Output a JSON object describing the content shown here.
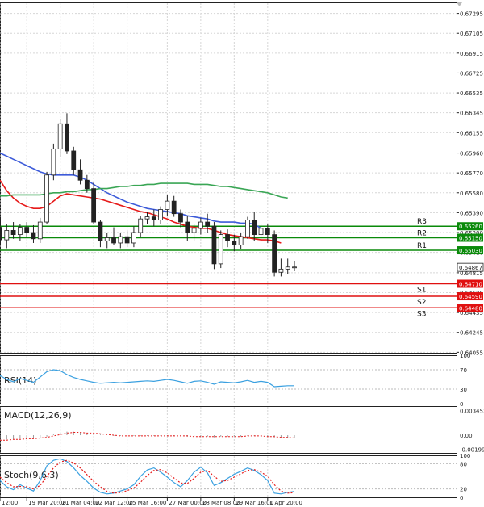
{
  "chart_data": [
    {
      "panel": "price",
      "type": "candlestick",
      "ylim": [
        0.6405,
        0.674
      ],
      "y_ticks": [
        "0.67295",
        "0.67105",
        "0.66915",
        "0.66725",
        "0.66535",
        "0.66345",
        "0.66155",
        "0.65960",
        "0.65770",
        "0.65580",
        "0.65390",
        "0.65200",
        "0.65010",
        "0.64815",
        "0.64625",
        "0.64435",
        "0.64245",
        "0.64055"
      ],
      "current_price": {
        "label": "0.64867",
        "value": 0.64867
      },
      "levels": [
        {
          "name": "R3",
          "value": 0.6526,
          "label": "0.65260",
          "kind": "resistance",
          "color": "#0a8a0a"
        },
        {
          "name": "R2",
          "value": 0.6515,
          "label": "0.65150",
          "kind": "resistance",
          "color": "#0a8a0a"
        },
        {
          "name": "R1",
          "value": 0.6503,
          "label": "0.65030",
          "kind": "resistance",
          "color": "#0a8a0a"
        },
        {
          "name": "S1",
          "value": 0.6471,
          "label": "0.64710",
          "kind": "support",
          "color": "#e01010"
        },
        {
          "name": "S2",
          "value": 0.6459,
          "label": "0.64590",
          "kind": "support",
          "color": "#e01010"
        },
        {
          "name": "S3",
          "value": 0.6448,
          "label": "0.64480",
          "kind": "support",
          "color": "#e01010"
        }
      ],
      "candles": [
        [
          0.6525,
          0.6535,
          0.6508,
          0.6513
        ],
        [
          0.6513,
          0.6528,
          0.6505,
          0.6522
        ],
        [
          0.6522,
          0.653,
          0.6514,
          0.6518
        ],
        [
          0.6518,
          0.6528,
          0.6512,
          0.6525
        ],
        [
          0.6525,
          0.653,
          0.6515,
          0.652
        ],
        [
          0.652,
          0.6527,
          0.651,
          0.6514
        ],
        [
          0.6514,
          0.6534,
          0.651,
          0.653
        ],
        [
          0.653,
          0.6578,
          0.6528,
          0.6575
        ],
        [
          0.6575,
          0.6605,
          0.657,
          0.66
        ],
        [
          0.66,
          0.6628,
          0.6592,
          0.6624
        ],
        [
          0.6624,
          0.6634,
          0.6595,
          0.6598
        ],
        [
          0.6598,
          0.6602,
          0.6575,
          0.658
        ],
        [
          0.658,
          0.659,
          0.6566,
          0.657
        ],
        [
          0.657,
          0.6575,
          0.6558,
          0.6562
        ],
        [
          0.6562,
          0.6568,
          0.6528,
          0.653
        ],
        [
          0.653,
          0.6532,
          0.6506,
          0.6512
        ],
        [
          0.6512,
          0.652,
          0.6505,
          0.6515
        ],
        [
          0.6515,
          0.6525,
          0.6508,
          0.651
        ],
        [
          0.651,
          0.652,
          0.6505,
          0.6516
        ],
        [
          0.6516,
          0.6522,
          0.6506,
          0.651
        ],
        [
          0.651,
          0.6526,
          0.6506,
          0.652
        ],
        [
          0.652,
          0.6536,
          0.6516,
          0.6533
        ],
        [
          0.6533,
          0.654,
          0.6528,
          0.6535
        ],
        [
          0.6535,
          0.6542,
          0.6526,
          0.6532
        ],
        [
          0.6532,
          0.6545,
          0.6528,
          0.6542
        ],
        [
          0.6542,
          0.6556,
          0.6536,
          0.655
        ],
        [
          0.655,
          0.6555,
          0.6535,
          0.6538
        ],
        [
          0.6538,
          0.6542,
          0.6525,
          0.653
        ],
        [
          0.653,
          0.6536,
          0.6512,
          0.652
        ],
        [
          0.652,
          0.6528,
          0.6512,
          0.6524
        ],
        [
          0.6524,
          0.6534,
          0.6518,
          0.653
        ],
        [
          0.653,
          0.6538,
          0.652,
          0.6526
        ],
        [
          0.6526,
          0.653,
          0.6485,
          0.649
        ],
        [
          0.649,
          0.6522,
          0.6486,
          0.6518
        ],
        [
          0.6518,
          0.6523,
          0.6506,
          0.6512
        ],
        [
          0.6512,
          0.6518,
          0.6502,
          0.6508
        ],
        [
          0.6508,
          0.652,
          0.6504,
          0.6516
        ],
        [
          0.6516,
          0.6535,
          0.6514,
          0.6532
        ],
        [
          0.6532,
          0.654,
          0.6512,
          0.6518
        ],
        [
          0.6518,
          0.6528,
          0.6512,
          0.6524
        ],
        [
          0.6524,
          0.6528,
          0.651,
          0.6518
        ],
        [
          0.6518,
          0.6522,
          0.6478,
          0.6482
        ],
        [
          0.6482,
          0.6495,
          0.6478,
          0.6485
        ],
        [
          0.6485,
          0.6495,
          0.648,
          0.6487
        ],
        [
          0.6487,
          0.6493,
          0.6483,
          0.6487
        ]
      ],
      "moving_averages": [
        {
          "color": "#3d5bd9",
          "start_index": 0,
          "values": [
            0.6596,
            0.6593,
            0.659,
            0.6587,
            0.6584,
            0.6581,
            0.6578,
            0.6576,
            0.6575,
            0.6575,
            0.6575,
            0.6575,
            0.6573,
            0.657,
            0.6566,
            0.6562,
            0.6558,
            0.6555,
            0.6552,
            0.6549,
            0.6547,
            0.6545,
            0.6543,
            0.6542,
            0.6541,
            0.654,
            0.6539,
            0.6538,
            0.6536,
            0.6535,
            0.6534,
            0.6533,
            0.6531,
            0.653,
            0.653,
            0.653,
            0.6529,
            0.6529,
            0.6528,
            0.6524
          ]
        },
        {
          "color": "#e61a1a",
          "start_index": 0,
          "values": [
            0.657,
            0.656,
            0.6553,
            0.6548,
            0.6545,
            0.6543,
            0.6543,
            0.6545,
            0.655,
            0.6555,
            0.6557,
            0.6556,
            0.6555,
            0.6554,
            0.6553,
            0.6552,
            0.655,
            0.6548,
            0.6546,
            0.6544,
            0.6542,
            0.654,
            0.6539,
            0.6537,
            0.6535,
            0.6533,
            0.653,
            0.6528,
            0.6526,
            0.6525,
            0.6524,
            0.6524,
            0.6522,
            0.652,
            0.6518,
            0.6517,
            0.6516,
            0.6515,
            0.6514,
            0.6513,
            0.6513,
            0.6512,
            0.651
          ]
        },
        {
          "color": "#3aa655",
          "start_index": 0,
          "values": [
            0.6555,
            0.6555,
            0.6556,
            0.6556,
            0.6556,
            0.6556,
            0.6556,
            0.6557,
            0.6558,
            0.6558,
            0.6559,
            0.6559,
            0.656,
            0.6561,
            0.6561,
            0.6562,
            0.6562,
            0.6563,
            0.6564,
            0.6564,
            0.6565,
            0.6565,
            0.6566,
            0.6566,
            0.6567,
            0.6567,
            0.6567,
            0.6567,
            0.6567,
            0.6566,
            0.6566,
            0.6566,
            0.6565,
            0.6564,
            0.6564,
            0.6563,
            0.6562,
            0.6561,
            0.656,
            0.6559,
            0.6558,
            0.6556,
            0.6554,
            0.6553
          ]
        }
      ]
    },
    {
      "panel": "rsi",
      "type": "line",
      "indicator": "RSI(14)",
      "ylim": [
        0,
        100
      ],
      "y_ticks": [
        {
          "label": "100",
          "value": 100
        },
        {
          "label": "70",
          "value": 70
        },
        {
          "label": "30",
          "value": 30
        },
        {
          "label": "0",
          "value": 0
        }
      ],
      "series": [
        {
          "color": "#3aa0e0",
          "values": [
            58,
            50,
            45,
            52,
            48,
            44,
            55,
            66,
            70,
            68,
            60,
            54,
            50,
            47,
            44,
            42,
            43,
            44,
            43,
            44,
            45,
            46,
            47,
            46,
            48,
            50,
            48,
            45,
            42,
            46,
            47,
            44,
            40,
            45,
            44,
            43,
            45,
            48,
            44,
            46,
            44,
            35,
            36,
            37,
            37
          ]
        }
      ]
    },
    {
      "panel": "macd",
      "type": "bar",
      "indicator": "MACD(12,26,9)",
      "ylim": [
        -0.0025,
        0.0041
      ],
      "y_ticks": [
        {
          "label": "0.003453",
          "value": 0.003453
        },
        {
          "label": "0.00",
          "value": 0.0
        },
        {
          "label": "-0.001999",
          "value": -0.001999
        }
      ],
      "series": [
        {
          "name": "histogram",
          "color": "#9a9a9a",
          "values": [
            -0.0005,
            -0.0006,
            -0.0006,
            -0.0005,
            -0.0005,
            -0.0005,
            -0.0004,
            -0.0002,
            0.0001,
            0.0004,
            0.0005,
            0.0005,
            0.0004,
            0.0003,
            0.0002,
            0.0001,
            0.0,
            -0.0001,
            -0.0001,
            -0.0001,
            -0.0001,
            -0.0001,
            -0.0001,
            -0.0001,
            -0.0001,
            -0.0001,
            -0.0001,
            -0.0001,
            -0.0002,
            -0.0002,
            -0.0002,
            -0.0002,
            -0.0003,
            -0.0002,
            -0.0002,
            -0.0002,
            -0.0002,
            -0.0001,
            -0.0001,
            -0.0002,
            -0.0002,
            -0.0003,
            -0.0004,
            -0.0004,
            -0.0004
          ]
        },
        {
          "name": "signal",
          "color": "#e61a1a",
          "values": [
            -0.0007,
            -0.0007,
            -0.0006,
            -0.0006,
            -0.0005,
            -0.0005,
            -0.0004,
            -0.0003,
            -0.0001,
            0.0001,
            0.0003,
            0.0004,
            0.0004,
            0.0003,
            0.0003,
            0.0002,
            0.0001,
            0.0,
            -0.0001,
            -0.0001,
            -0.0001,
            -0.0001,
            -0.0001,
            -0.0001,
            -0.0001,
            -0.0001,
            -0.0001,
            -0.0001,
            -0.0001,
            -0.0002,
            -0.0002,
            -0.0002,
            -0.0002,
            -0.0002,
            -0.0002,
            -0.0002,
            -0.0002,
            -0.0001,
            -0.0001,
            -0.0001,
            -0.0002,
            -0.0002,
            -0.0003,
            -0.0003,
            -0.0004
          ]
        }
      ]
    },
    {
      "panel": "stochastic",
      "type": "line",
      "indicator": "Stoch(9,6,3)",
      "ylim": [
        0,
        100
      ],
      "y_ticks": [
        {
          "label": "100",
          "value": 100
        },
        {
          "label": "80",
          "value": 80
        },
        {
          "label": "20",
          "value": 20
        },
        {
          "label": "0",
          "value": 0
        }
      ],
      "series": [
        {
          "color": "#3aa0e0",
          "values": [
            40,
            25,
            18,
            30,
            22,
            15,
            40,
            75,
            88,
            92,
            85,
            70,
            52,
            38,
            22,
            12,
            8,
            10,
            15,
            20,
            30,
            50,
            65,
            70,
            60,
            48,
            35,
            25,
            40,
            60,
            72,
            58,
            28,
            35,
            45,
            55,
            62,
            70,
            64,
            54,
            40,
            10,
            8,
            12,
            14
          ]
        },
        {
          "color": "#e61a1a",
          "dashed": true,
          "values": [
            48,
            35,
            25,
            26,
            25,
            20,
            28,
            50,
            70,
            84,
            88,
            82,
            70,
            54,
            38,
            25,
            14,
            10,
            11,
            16,
            22,
            36,
            52,
            64,
            66,
            58,
            46,
            34,
            33,
            45,
            60,
            64,
            50,
            38,
            40,
            48,
            56,
            64,
            66,
            60,
            50,
            30,
            15,
            10,
            11
          ]
        }
      ]
    }
  ],
  "x_axis": {
    "labels": [
      {
        "text": "12:00",
        "index": 0
      },
      {
        "text": "19 Mar 20:00",
        "index": 4
      },
      {
        "text": "21 Mar 04:00",
        "index": 9
      },
      {
        "text": "22 Mar 12:00",
        "index": 14
      },
      {
        "text": "25 Mar 16:00",
        "index": 19
      },
      {
        "text": "27 Mar 00:00",
        "index": 25
      },
      {
        "text": "28 Mar 08:00",
        "index": 30
      },
      {
        "text": "29 Mar 16:00",
        "index": 35
      },
      {
        "text": "1 Apr 20:00",
        "index": 40
      }
    ]
  }
}
